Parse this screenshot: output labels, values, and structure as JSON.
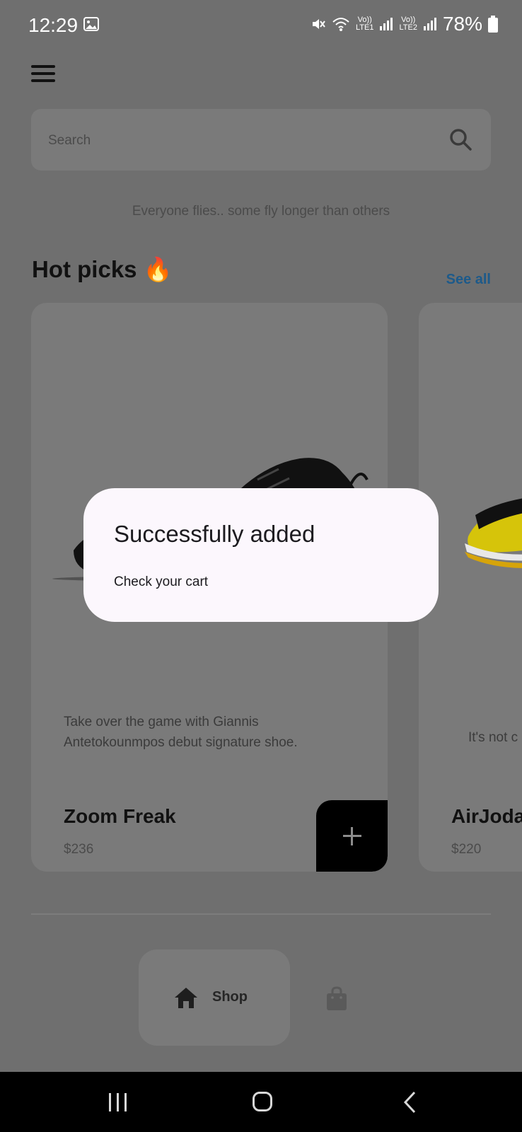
{
  "status_bar": {
    "time": "12:29",
    "network_1": "LTE1",
    "network_2": "LTE2",
    "volte_1": "Vo))",
    "volte_2": "Vo))",
    "battery": "78%"
  },
  "search": {
    "placeholder": "Search"
  },
  "tagline": "Everyone flies.. some fly longer than others",
  "section": {
    "title": "Hot picks",
    "see_all": "See all",
    "emoji": "🔥"
  },
  "products": [
    {
      "name": "Zoom Freak",
      "price": "$236",
      "description": "Take over the game with Giannis Antetokounmpos debut signature shoe."
    },
    {
      "name": "AirJoda",
      "price": "$220",
      "description": "It's not c"
    }
  ],
  "bottom_nav": {
    "shop_label": "Shop"
  },
  "dialog": {
    "title": "Successfully added",
    "body": "Check your cart"
  },
  "colors": {
    "accent": "#1d5a8a",
    "scrim": "#6f6f6f",
    "dialog_bg": "#fcf7fd"
  },
  "icons": [
    "menu-icon",
    "search-icon",
    "plus-icon",
    "home-icon",
    "shopping-bag-icon",
    "recent-apps-icon",
    "home-button-icon",
    "back-icon"
  ]
}
